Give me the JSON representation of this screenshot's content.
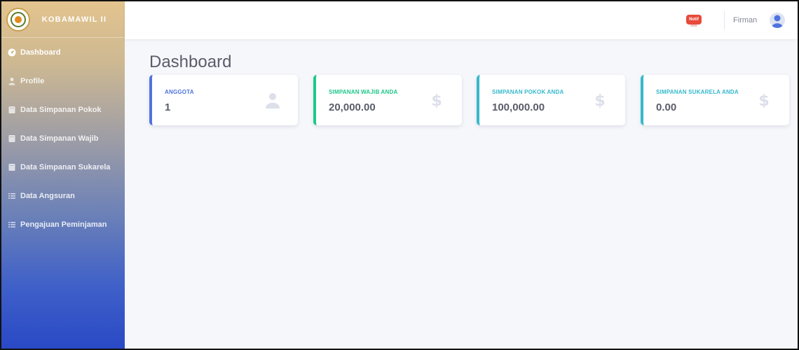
{
  "brand": {
    "name": "KOBAMAWIL II"
  },
  "sidebar": {
    "items": [
      {
        "label": "Dashboard",
        "icon": "dashboard-gauge-icon",
        "active": true
      },
      {
        "label": "Profile",
        "icon": "user-icon"
      },
      {
        "label": "Data Simpanan Pokok",
        "icon": "book-icon"
      },
      {
        "label": "Data Simpanan Wajib",
        "icon": "book-icon"
      },
      {
        "label": "Data Simpanan Sukarela",
        "icon": "book-icon"
      },
      {
        "label": "Data Angsuran",
        "icon": "list-icon"
      },
      {
        "label": "Pengajuan Peminjaman",
        "icon": "list-icon"
      }
    ]
  },
  "topbar": {
    "notif_label": "Notif",
    "user_name": "Firman"
  },
  "main": {
    "title": "Dashboard",
    "cards": [
      {
        "label": "ANGGOTA",
        "value": "1",
        "icon": "user-icon",
        "accent": "#4e73df"
      },
      {
        "label": "SIMPANAN WAJIB ANDA",
        "value": "20,000.00",
        "icon": "dollar-icon",
        "accent": "#1cc88a"
      },
      {
        "label": "SIMPANAN POKOK ANDA",
        "value": "100,000.00",
        "icon": "dollar-icon",
        "accent": "#36b9cc"
      },
      {
        "label": "SIMPANAN SUKARELA ANDA",
        "value": "0.00",
        "icon": "dollar-icon",
        "accent": "#36b9cc"
      }
    ]
  }
}
